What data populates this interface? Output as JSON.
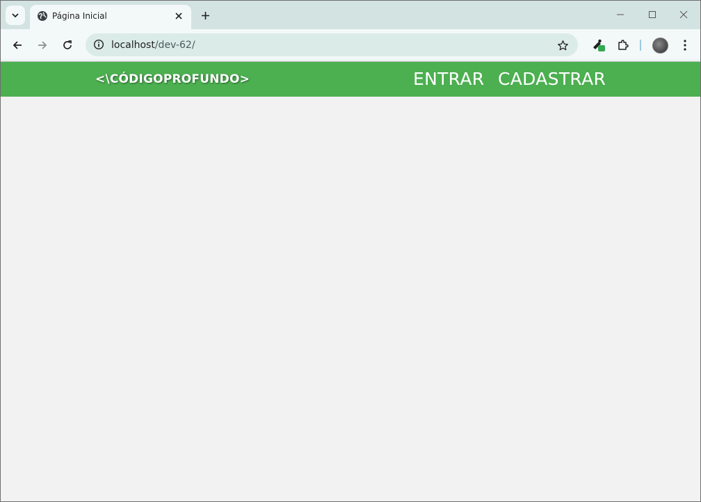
{
  "browser": {
    "tab": {
      "title": "Página Inicial"
    },
    "address": {
      "host": "localhost",
      "path": "/dev-62/"
    },
    "icons": {
      "tab_search": "chevron-down-icon",
      "favicon": "globe-icon",
      "tab_close": "close-icon",
      "new_tab": "plus-icon",
      "minimize": "minimize-icon",
      "maximize": "maximize-icon",
      "close_window": "close-icon",
      "back": "arrow-left-icon",
      "forward": "arrow-right-icon",
      "reload": "reload-icon",
      "site_info": "info-icon",
      "bookmark": "star-icon",
      "extension_pen": "pen-extension-icon",
      "extensions": "puzzle-icon",
      "menu": "kebab-menu-icon"
    }
  },
  "site": {
    "brand": "<\\CÓDIGOPROFUNDO>",
    "nav": [
      {
        "label": "ENTRAR"
      },
      {
        "label": "CADASTRAR"
      }
    ],
    "colors": {
      "header": "#4caf50",
      "background": "#f2f2f2",
      "text": "#ffffff"
    }
  }
}
